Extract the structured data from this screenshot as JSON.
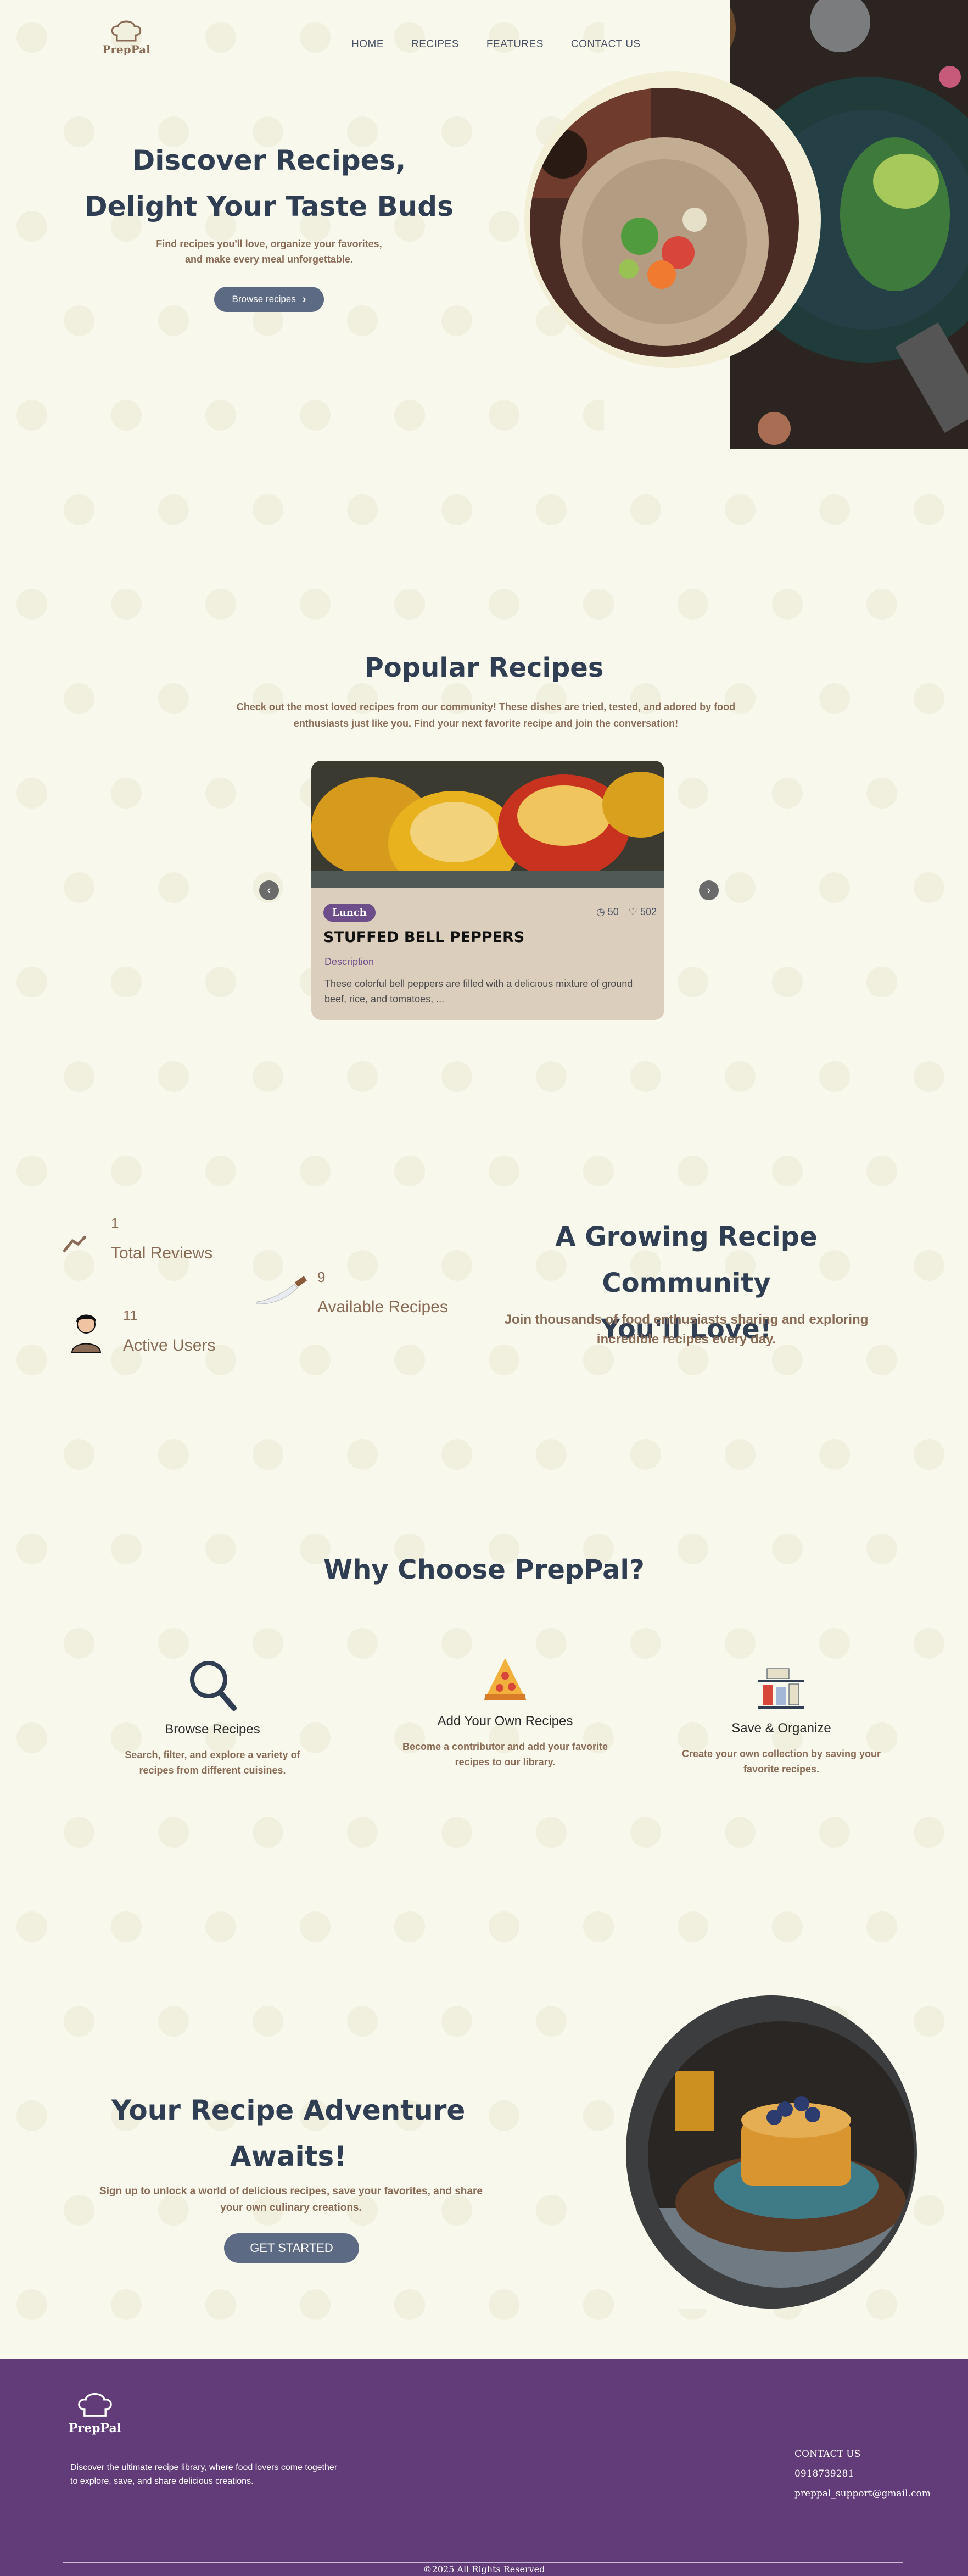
{
  "brand": {
    "name": "PrepPal"
  },
  "nav": {
    "items": [
      "HOME",
      "RECIPES",
      "FEATURES",
      "CONTACT US"
    ]
  },
  "hero": {
    "title_line1": "Discover Recipes,",
    "title_line2": "Delight Your Taste Buds",
    "subtitle_line1": "Find recipes you'll love, organize your favorites,",
    "subtitle_line2": "and make every meal unforgettable.",
    "button": "Browse recipes"
  },
  "popular": {
    "title": "Popular Recipes",
    "subtitle": "Check out the most loved recipes from our community! These dishes are tried, tested, and adored by food enthusiasts just like you. Find your next favorite recipe and join the conversation!",
    "card": {
      "category": "Lunch",
      "time": "50",
      "likes": "502",
      "title": "STUFFED BELL PEPPERS",
      "desc_label": "Description",
      "description": "These colorful bell peppers are filled with a delicious mixture of ground beef, rice, and tomatoes, ..."
    }
  },
  "community": {
    "stats": [
      {
        "num": "1",
        "label": "Total Reviews"
      },
      {
        "num": "9",
        "label": "Available Recipes"
      },
      {
        "num": "11",
        "label": "Active Users"
      }
    ],
    "title_line1": "A Growing Recipe Community",
    "title_line2": "You'll Love!",
    "subtitle": "Join thousands of food enthusiasts sharing and exploring incredible recipes every day."
  },
  "why": {
    "title": "Why Choose PrepPal?",
    "features": [
      {
        "icon": "magnifier-icon",
        "title": "Browse Recipes",
        "desc": "Search, filter, and explore a variety of recipes from different cuisines."
      },
      {
        "icon": "pizza-slice-icon",
        "title": "Add Your Own Recipes",
        "desc": "Become a contributor and add your favorite recipes to our library."
      },
      {
        "icon": "shelf-jars-icon",
        "title": "Save & Organize",
        "desc": "Create your own collection by saving your favorite recipes."
      }
    ]
  },
  "adventure": {
    "title_line1": "Your Recipe Adventure",
    "title_line2": "Awaits!",
    "subtitle": "Sign up to unlock a world of delicious recipes, save your favorites, and share your own culinary creations.",
    "button": "GET STARTED"
  },
  "footer": {
    "description": "Discover the ultimate recipe library, where food lovers come together to explore, save, and share delicious creations.",
    "contact_heading": "CONTACT US",
    "phone": "0918739281",
    "email": "preppal_support@gmail.com",
    "copyright": "©2025 All Rights Reserved"
  },
  "colors": {
    "background": "#f9f8ec",
    "heading": "#2f3e52",
    "accent_text": "#8a6b55",
    "button": "#5d6a84",
    "footer": "#623c78",
    "badge": "#6d4d8a"
  }
}
